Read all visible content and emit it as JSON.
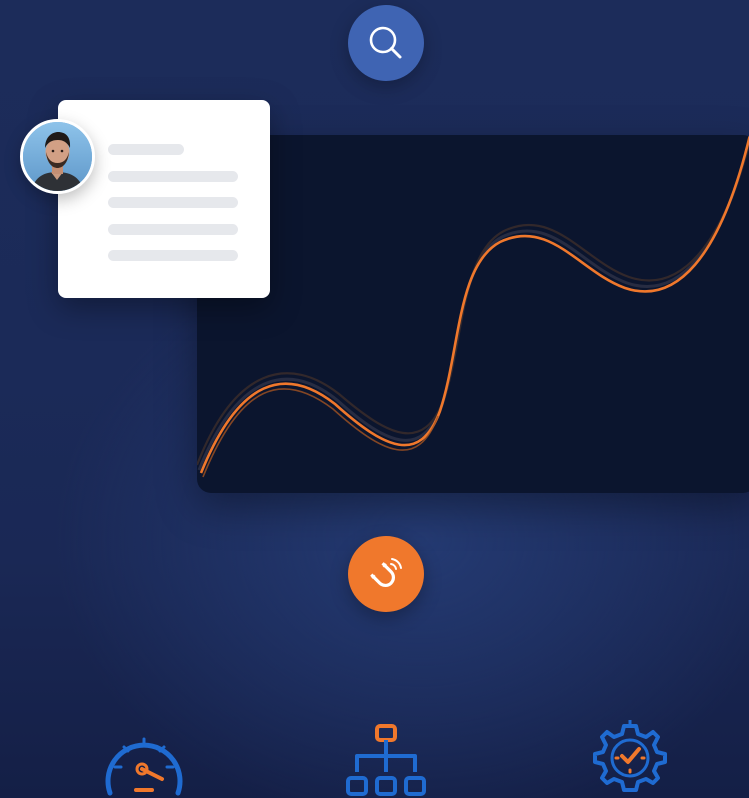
{
  "colors": {
    "background": "#1b2a58",
    "panel": "#0b152e",
    "accent_orange": "#f0782c",
    "accent_blue": "#3f64b3",
    "icon_blue": "#1f6bd1",
    "card": "#ffffff",
    "skeleton": "#e6e8ec"
  },
  "icons": {
    "search": "search-icon",
    "magnet": "magnet-icon",
    "speedometer": "speedometer-icon",
    "hierarchy": "hierarchy-icon",
    "gear_clock": "gear-clock-icon"
  },
  "profile_card": {
    "avatar": "person-avatar",
    "skeleton_lines": 5
  }
}
